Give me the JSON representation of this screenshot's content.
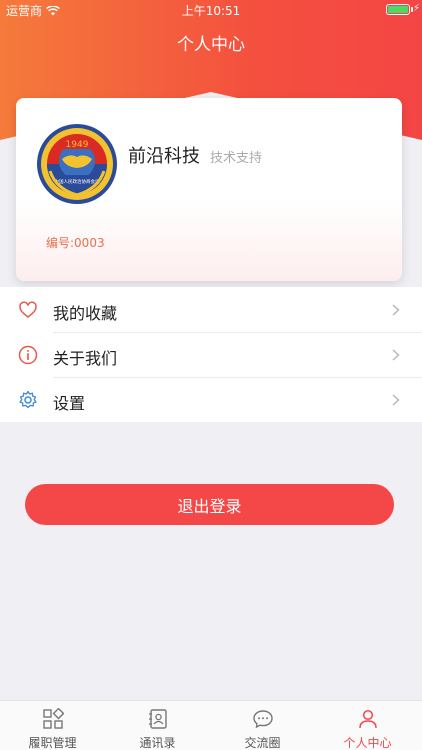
{
  "status_bar": {
    "carrier": "运营商",
    "time": "上午10:51"
  },
  "nav": {
    "title": "个人中心"
  },
  "profile": {
    "emblem_year": "1949",
    "emblem_text": "中国人民政治协商会议",
    "name": "前沿科技",
    "support": "技术支持",
    "member_id": "编号:0003"
  },
  "menu": {
    "favorites": "我的收藏",
    "about": "关于我们",
    "settings": "设置"
  },
  "logout": {
    "label": "退出登录"
  },
  "tabs": [
    {
      "label": "履职管理",
      "icon": "grid-icon"
    },
    {
      "label": "通讯录",
      "icon": "contacts-icon"
    },
    {
      "label": "交流圈",
      "icon": "chat-icon"
    },
    {
      "label": "个人中心",
      "icon": "person-icon",
      "active": true
    }
  ],
  "colors": {
    "accent": "#f44848",
    "header_start": "#f57a3b",
    "battery": "#4cd964"
  }
}
